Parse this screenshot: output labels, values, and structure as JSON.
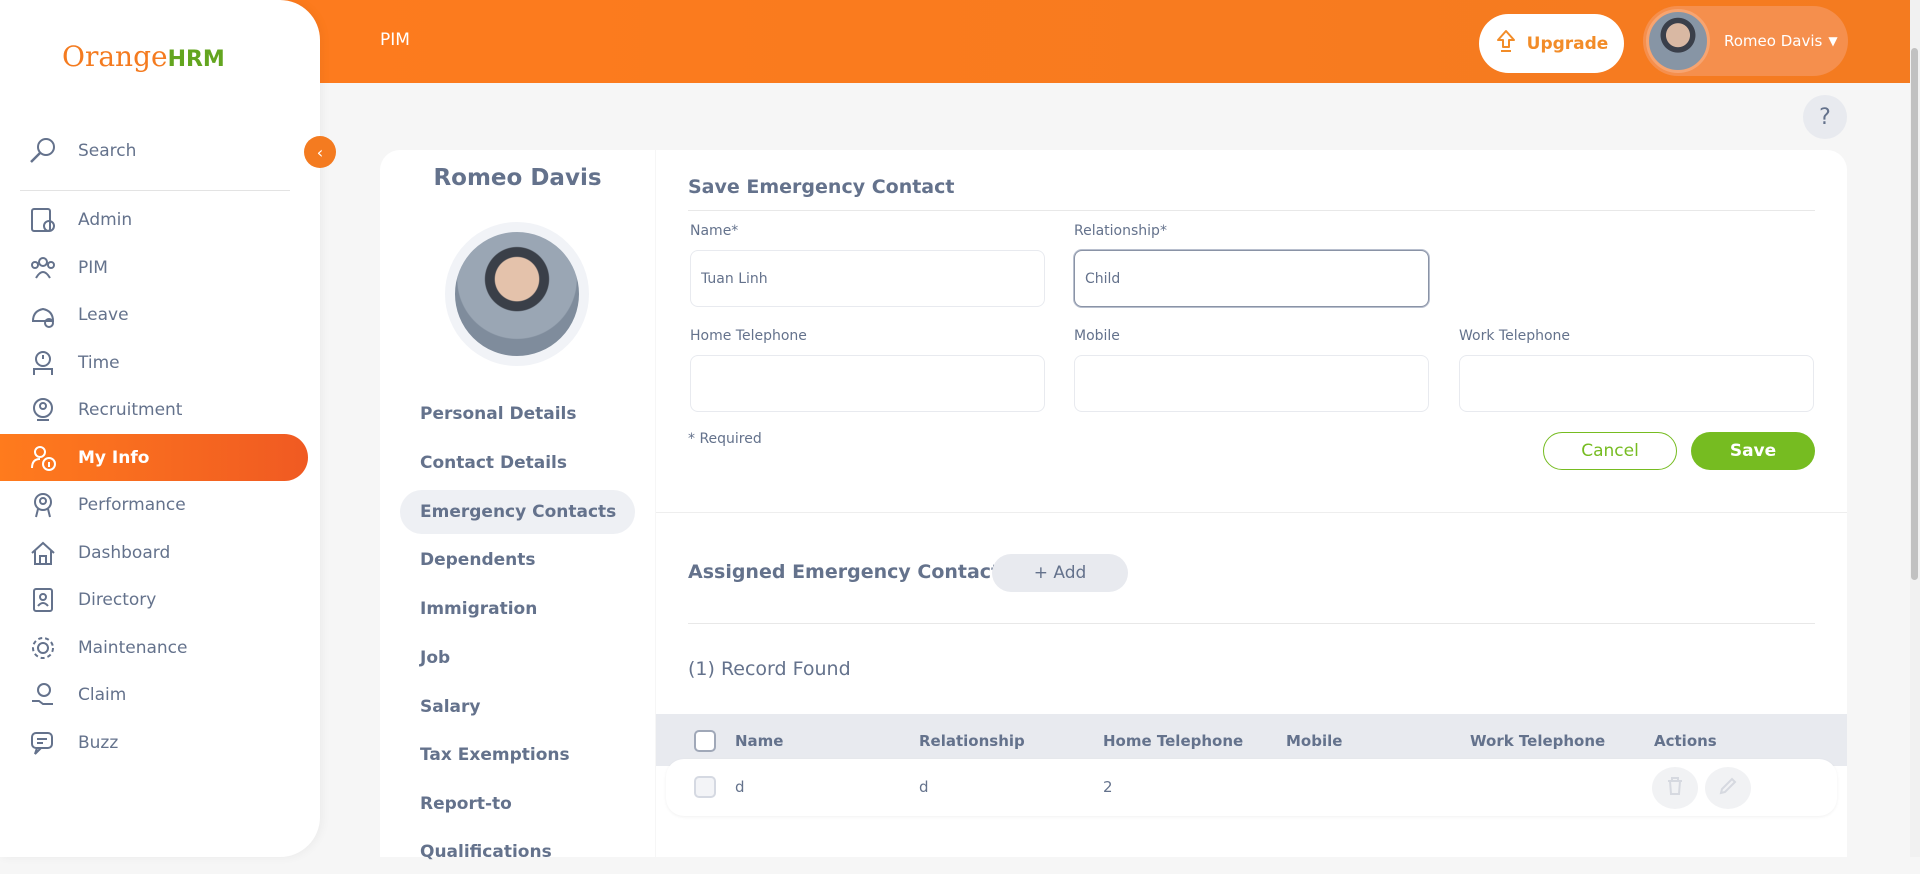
{
  "topbar": {
    "title": "PIM",
    "upgrade_label": "Upgrade",
    "user_name": "Romeo Davis"
  },
  "logo": {
    "orange": "Orange",
    "hrm": "HRM"
  },
  "sidebar": {
    "search_label": "Search",
    "items": [
      {
        "label": "Admin",
        "icon": "admin-icon"
      },
      {
        "label": "PIM",
        "icon": "pim-icon"
      },
      {
        "label": "Leave",
        "icon": "leave-icon"
      },
      {
        "label": "Time",
        "icon": "time-icon"
      },
      {
        "label": "Recruitment",
        "icon": "recruitment-icon"
      },
      {
        "label": "My Info",
        "icon": "my-info-icon",
        "active": true
      },
      {
        "label": "Performance",
        "icon": "performance-icon"
      },
      {
        "label": "Dashboard",
        "icon": "dashboard-icon"
      },
      {
        "label": "Directory",
        "icon": "directory-icon"
      },
      {
        "label": "Maintenance",
        "icon": "maintenance-icon"
      },
      {
        "label": "Claim",
        "icon": "claim-icon"
      },
      {
        "label": "Buzz",
        "icon": "buzz-icon"
      }
    ]
  },
  "help": {
    "label": "?"
  },
  "profile": {
    "name": "Romeo Davis",
    "tabs": [
      "Personal Details",
      "Contact Details",
      "Emergency Contacts",
      "Dependents",
      "Immigration",
      "Job",
      "Salary",
      "Tax Exemptions",
      "Report-to",
      "Qualifications"
    ]
  },
  "form": {
    "title": "Save Emergency Contact",
    "name_label": "Name*",
    "name_value": "Tuan Linh",
    "relationship_label": "Relationship*",
    "relationship_value": "Child",
    "home_label": "Home Telephone",
    "mobile_label": "Mobile",
    "work_label": "Work Telephone",
    "required_note": "* Required",
    "cancel_label": "Cancel",
    "save_label": "Save"
  },
  "assigned": {
    "title": "Assigned Emergency Contacts",
    "add_label": "+ Add",
    "records_text": "(1) Record Found",
    "columns": [
      "Name",
      "Relationship",
      "Home Telephone",
      "Mobile",
      "Work Telephone",
      "Actions"
    ],
    "rows": [
      {
        "name": "d",
        "relationship": "d",
        "home": "2",
        "mobile": "",
        "work": ""
      }
    ]
  },
  "colors": {
    "brand": "#f47b20",
    "accent_green": "#76bc21",
    "text": "#64728c"
  }
}
